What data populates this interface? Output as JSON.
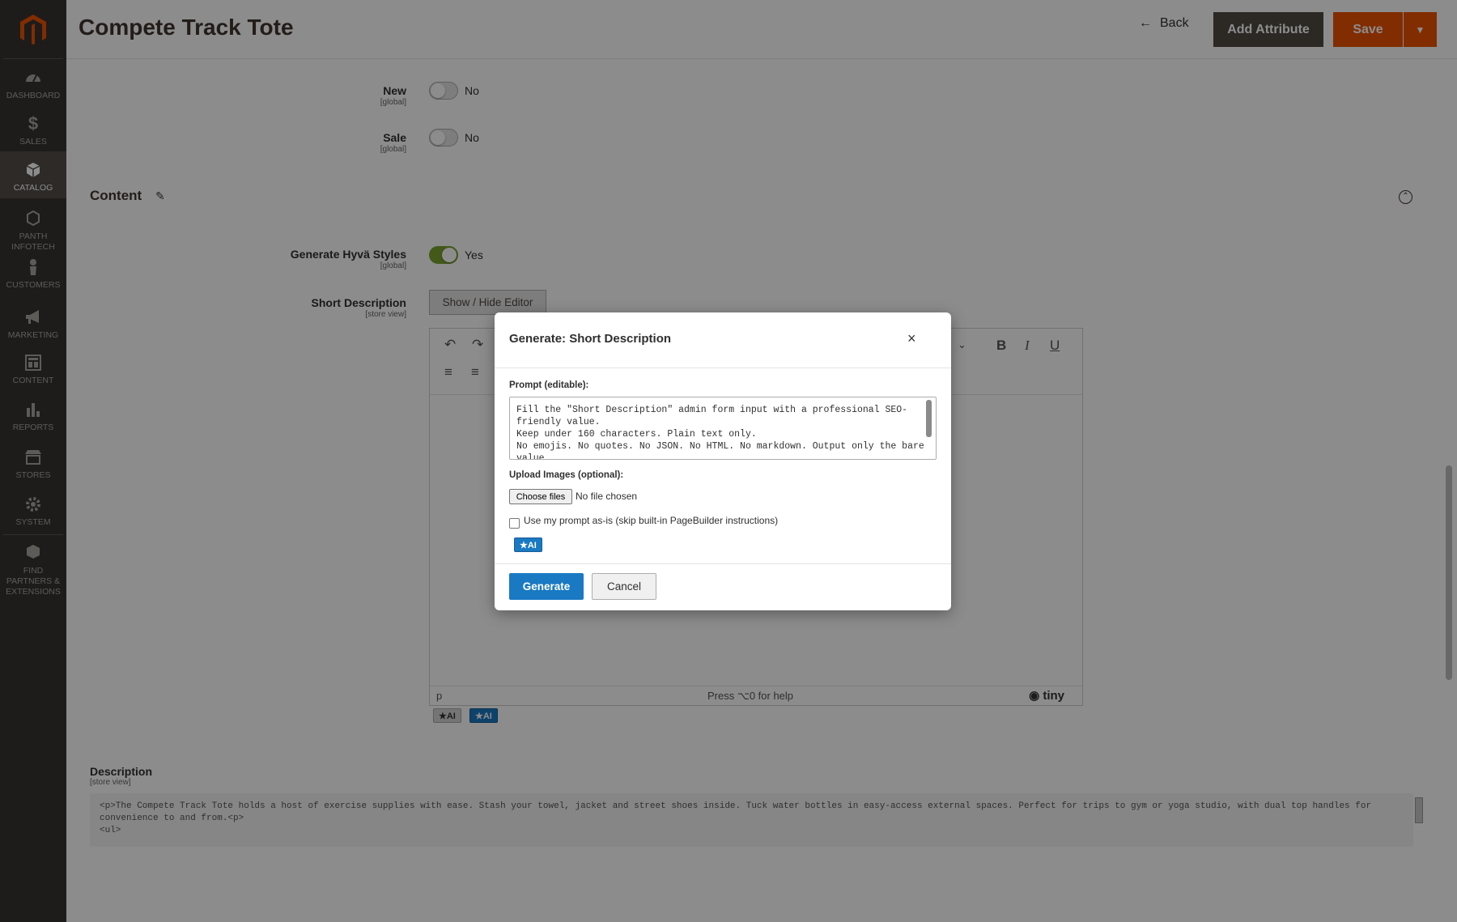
{
  "brand": {
    "accent": "#eb5202",
    "sidebar_bg": "#373330",
    "primary_blue": "#1979c3"
  },
  "sidebar": {
    "items": [
      {
        "label": "DASHBOARD",
        "icon": "speedometer-icon"
      },
      {
        "label": "SALES",
        "icon": "dollar-icon"
      },
      {
        "label": "CATALOG",
        "icon": "cube-icon",
        "active": true
      },
      {
        "label": "PANTH INFOTECH",
        "icon": "hexagon-icon"
      },
      {
        "label": "CUSTOMERS",
        "icon": "person-icon"
      },
      {
        "label": "MARKETING",
        "icon": "megaphone-icon"
      },
      {
        "label": "CONTENT",
        "icon": "layout-icon"
      },
      {
        "label": "REPORTS",
        "icon": "bar-chart-icon"
      },
      {
        "label": "STORES",
        "icon": "storefront-icon"
      },
      {
        "label": "SYSTEM",
        "icon": "gear-icon"
      },
      {
        "label": "FIND PARTNERS & EXTENSIONS",
        "icon": "boxes-icon"
      }
    ]
  },
  "header": {
    "title": "Compete Track Tote",
    "back_label": "Back",
    "add_attribute_label": "Add Attribute",
    "save_label": "Save"
  },
  "form": {
    "new": {
      "label": "New",
      "scope": "[global]",
      "value_text": "No"
    },
    "sale": {
      "label": "Sale",
      "scope": "[global]",
      "value_text": "No"
    },
    "content_section_title": "Content",
    "hyva": {
      "label": "Generate Hyvä Styles",
      "scope": "[global]",
      "value_text": "Yes"
    },
    "short_description": {
      "label": "Short Description",
      "scope": "[store view]",
      "show_hide_label": "Show / Hide Editor"
    },
    "editor": {
      "status_path": "p",
      "status_help": "Press ⌥0 for help",
      "brand": "tiny",
      "ai_chip_1": "★AI",
      "ai_chip_2": "★AI"
    },
    "description": {
      "label": "Description",
      "scope": "[store view]",
      "line1": "<p>The Compete Track Tote holds a host of exercise supplies with ease. Stash your towel, jacket and street shoes inside. Tuck water bottles in easy-access external spaces. Perfect for trips to gym or yoga studio, with dual top handles for",
      "line2": "convenience to and from.<p>",
      "line3": "<ul>"
    }
  },
  "modal": {
    "title": "Generate: Short Description",
    "close_label": "×",
    "prompt_label": "Prompt (editable):",
    "prompt_value": "Fill the \"Short Description\" admin form input with a professional SEO-friendly value.\nKeep under 160 characters. Plain text only.\nNo emojis. No quotes. No JSON. No HTML. No markdown. Output only the bare value.",
    "upload_label": "Upload Images (optional):",
    "choose_files_label": "Choose files",
    "no_file_text": "No file chosen",
    "checkbox_label": "Use my prompt as-is (skip built-in PageBuilder instructions)",
    "ai_badge": "★AI",
    "generate_label": "Generate",
    "cancel_label": "Cancel"
  }
}
